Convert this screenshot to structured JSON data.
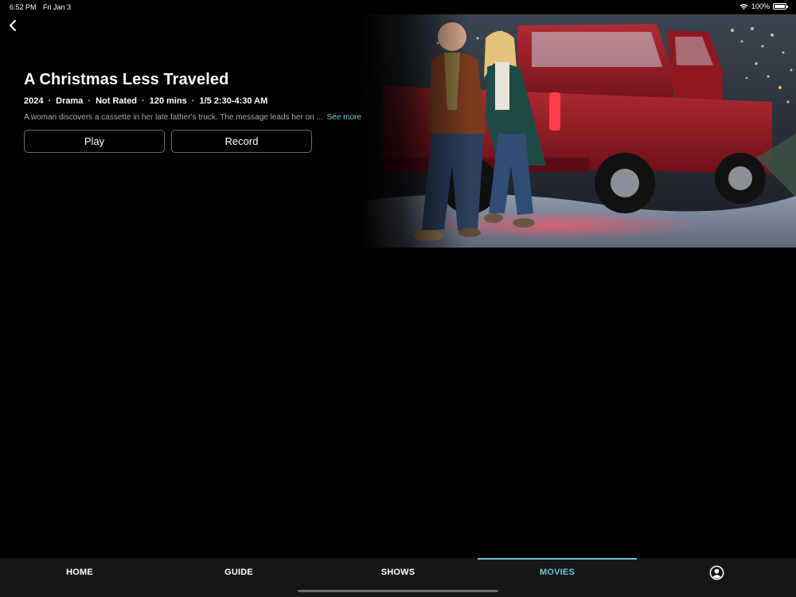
{
  "status_bar": {
    "time": "6:52 PM",
    "date": "Fri Jan 3",
    "battery": "100%"
  },
  "movie": {
    "title": "A Christmas Less Traveled",
    "year": "2024",
    "genre": "Drama",
    "rating": "Not Rated",
    "duration": "120 mins",
    "airtime": "1/5 2:30-4:30 AM",
    "synopsis": "A woman discovers a cassette in her late father's truck. The message leads her on ...",
    "see_more_label": "See more"
  },
  "actions": {
    "play_label": "Play",
    "record_label": "Record"
  },
  "tabs": [
    {
      "label": "HOME",
      "active": false
    },
    {
      "label": "GUIDE",
      "active": false
    },
    {
      "label": "SHOWS",
      "active": false
    },
    {
      "label": "MOVIES",
      "active": true
    }
  ],
  "icons": {
    "back": "chevron-left-icon",
    "wifi": "wifi-icon",
    "battery": "battery-icon",
    "profile": "profile-icon"
  },
  "colors": {
    "accent": "#6ec6d8",
    "background": "#000000",
    "tab_bar": "#161616",
    "truck": "#8e1822"
  }
}
